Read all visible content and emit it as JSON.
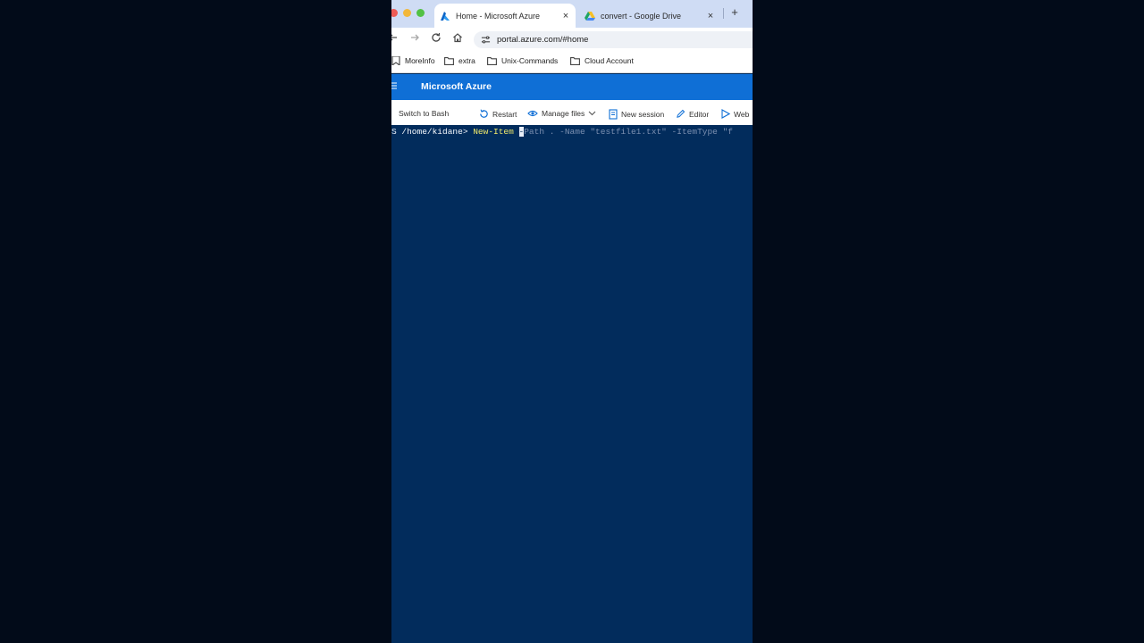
{
  "browser": {
    "tabs": [
      {
        "title": "Home - Microsoft Azure",
        "active": true,
        "favicon": "azure-icon"
      },
      {
        "title": "convert - Google Drive",
        "active": false,
        "favicon": "google-drive-icon"
      }
    ],
    "tab_close_glyph": "×",
    "new_tab_glyph": "+",
    "address": "portal.azure.com/#home",
    "bookmarks": [
      {
        "label": "MoreInfo",
        "icon": "bookmark-icon"
      },
      {
        "label": "extra",
        "icon": "folder-icon"
      },
      {
        "label": "Unix-Commands",
        "icon": "folder-icon"
      },
      {
        "label": "Cloud Account",
        "icon": "folder-icon"
      }
    ]
  },
  "azure": {
    "brand": "Microsoft Azure",
    "header_color": "#0f6fd6"
  },
  "shell_toolbar": {
    "switch": "Switch to Bash",
    "restart": "Restart",
    "manage_files": "Manage files",
    "new_session": "New session",
    "editor": "Editor",
    "web": "Web"
  },
  "terminal": {
    "prompt_edge": "S",
    "prompt": " /home/kidane> ",
    "command": "New-Item ",
    "cursor_char": "-",
    "suggestion": "Path . -Name \"testfile1.txt\" -ItemType \"f",
    "background": "#022c5c",
    "command_color": "#f1e96a"
  }
}
